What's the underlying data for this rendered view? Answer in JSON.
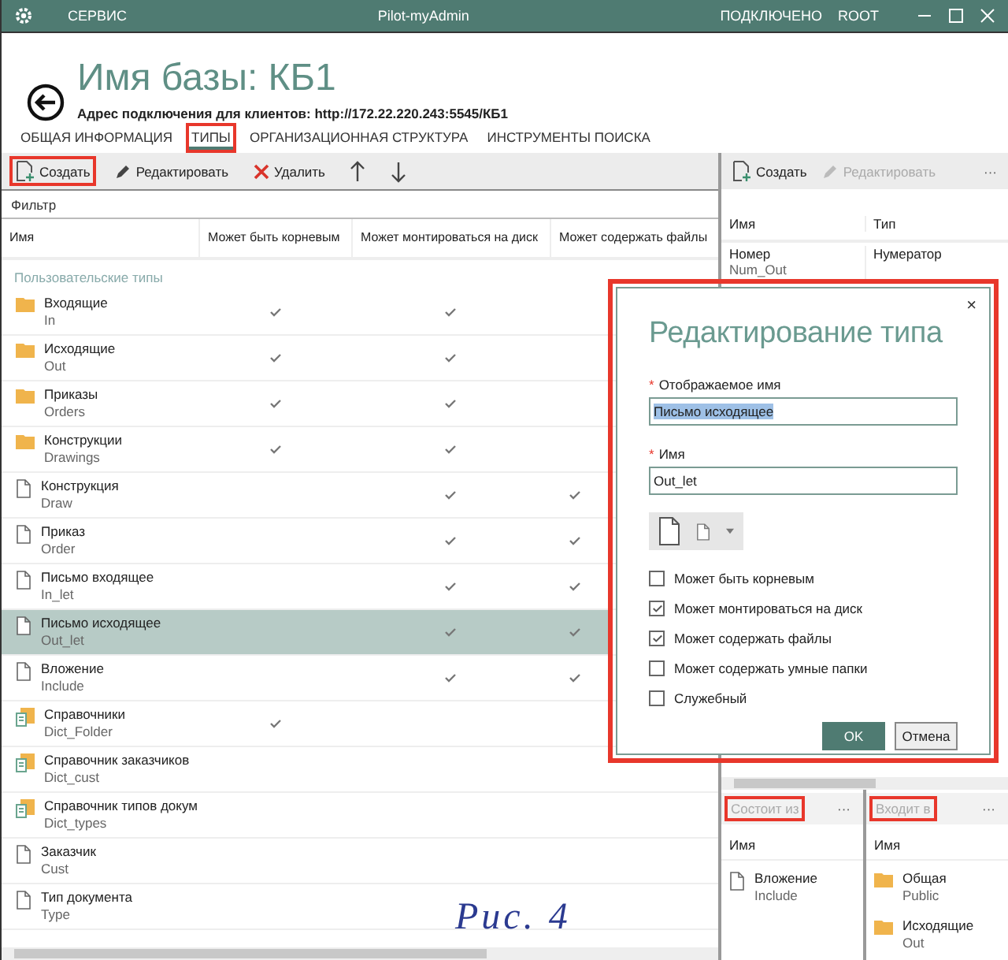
{
  "title_bar": {
    "menu": "СЕРВИС",
    "title": "Pilot-myAdmin",
    "status": "ПОДКЛЮЧЕНО",
    "user": "ROOT"
  },
  "header": {
    "title": "Имя базы: КБ1",
    "address": "Адрес подключения для клиентов: http://172.22.220.243:5545/КБ1"
  },
  "tabs": [
    {
      "label": "ОБЩАЯ ИНФОРМАЦИЯ",
      "selected": false,
      "annotated": false
    },
    {
      "label": "ТИПЫ",
      "selected": true,
      "annotated": true
    },
    {
      "label": "ОРГАНИЗАЦИОННАЯ СТРУКТУРА",
      "selected": false,
      "annotated": false
    },
    {
      "label": "ИНСТРУМЕНТЫ ПОИСКА",
      "selected": false,
      "annotated": false
    }
  ],
  "toolbar": [
    {
      "kind": "create",
      "label": "Создать",
      "annotated": true
    },
    {
      "kind": "edit",
      "label": "Редактировать",
      "annotated": false
    },
    {
      "kind": "delete",
      "label": "Удалить",
      "annotated": false
    },
    {
      "kind": "up",
      "annotated": false
    },
    {
      "kind": "down",
      "annotated": false
    }
  ],
  "filter": {
    "placeholder": "Фильтр"
  },
  "table": {
    "columns": [
      "Имя",
      "Может быть корневым",
      "Может монтироваться на диск",
      "Может содержать файлы"
    ],
    "group": "Пользовательские типы",
    "rows": [
      {
        "kind": "folder",
        "name": "Входящие",
        "code": "In",
        "root": true,
        "mount": true,
        "files": false,
        "selected": false
      },
      {
        "kind": "folder",
        "name": "Исходящие",
        "code": "Out",
        "root": true,
        "mount": true,
        "files": false,
        "selected": false
      },
      {
        "kind": "folder",
        "name": "Приказы",
        "code": "Orders",
        "root": true,
        "mount": true,
        "files": false,
        "selected": false
      },
      {
        "kind": "folder",
        "name": "Конструкции",
        "code": "Drawings",
        "root": true,
        "mount": true,
        "files": false,
        "selected": false
      },
      {
        "kind": "document",
        "name": "Конструкция",
        "code": "Draw",
        "root": false,
        "mount": true,
        "files": true,
        "selected": false
      },
      {
        "kind": "document",
        "name": "Приказ",
        "code": "Order",
        "root": false,
        "mount": true,
        "files": true,
        "selected": false
      },
      {
        "kind": "document",
        "name": "Письмо входящее",
        "code": "In_let",
        "root": false,
        "mount": true,
        "files": true,
        "selected": false
      },
      {
        "kind": "document",
        "name": "Письмо исходящее",
        "code": "Out_let",
        "root": false,
        "mount": true,
        "files": true,
        "selected": true
      },
      {
        "kind": "document",
        "name": "Вложение",
        "code": "Include",
        "root": false,
        "mount": true,
        "files": true,
        "selected": false
      },
      {
        "kind": "dictionary",
        "name": "Справочники",
        "code": "Dict_Folder",
        "root": true,
        "mount": false,
        "files": false,
        "selected": false
      },
      {
        "kind": "dictionary",
        "name": "Справочник заказчиков",
        "code": "Dict_cust",
        "root": false,
        "mount": false,
        "files": false,
        "selected": false
      },
      {
        "kind": "dictionary",
        "name": "Справочник типов докум",
        "code": "Dict_types",
        "root": false,
        "mount": false,
        "files": false,
        "selected": false
      },
      {
        "kind": "document",
        "name": "Заказчик",
        "code": "Cust",
        "root": false,
        "mount": false,
        "files": false,
        "selected": false
      },
      {
        "kind": "document",
        "name": "Тип документа",
        "code": "Type",
        "root": false,
        "mount": false,
        "files": false,
        "selected": false
      }
    ]
  },
  "attributes_panel": {
    "toolbar": [
      {
        "label": "Создать",
        "disabled": false
      },
      {
        "label": "Редактировать",
        "disabled": true
      }
    ],
    "more": "···",
    "columns": [
      "Имя",
      "Тип"
    ],
    "rows": [
      {
        "name": "Номер",
        "code": "Num_Out",
        "type": "Нумератор"
      }
    ]
  },
  "consists_of": {
    "title": "Состоит из",
    "annotated": true,
    "more": "···",
    "column": "Имя",
    "rows": [
      {
        "kind": "document",
        "name": "Вложение",
        "code": "Include"
      }
    ]
  },
  "included_in": {
    "title": "Входит в",
    "annotated": true,
    "more": "···",
    "column": "Имя",
    "rows": [
      {
        "kind": "folder",
        "name": "Общая",
        "code": "Public"
      },
      {
        "kind": "folder",
        "name": "Исходящие",
        "code": "Out"
      }
    ]
  },
  "dialog": {
    "title": "Редактирование типа",
    "annotated": true,
    "close": "×",
    "fields": [
      {
        "label": "Отображаемое имя",
        "mark": "*",
        "value": "Письмо исходящее",
        "highlighted": true
      },
      {
        "label": "Имя",
        "mark": "*",
        "value": "Out_let",
        "highlighted": false
      }
    ],
    "options": [
      {
        "label": "Может быть корневым",
        "checked": false
      },
      {
        "label": "Может монтироваться на диск",
        "checked": true
      },
      {
        "label": "Может содержать файлы",
        "checked": true
      },
      {
        "label": "Может содержать умные папки",
        "checked": false
      },
      {
        "label": "Служебный",
        "checked": false
      }
    ],
    "buttons": [
      {
        "label": "OK",
        "primary": true
      },
      {
        "label": "Отмена",
        "primary": false
      }
    ]
  },
  "caption": "Рис. 4"
}
